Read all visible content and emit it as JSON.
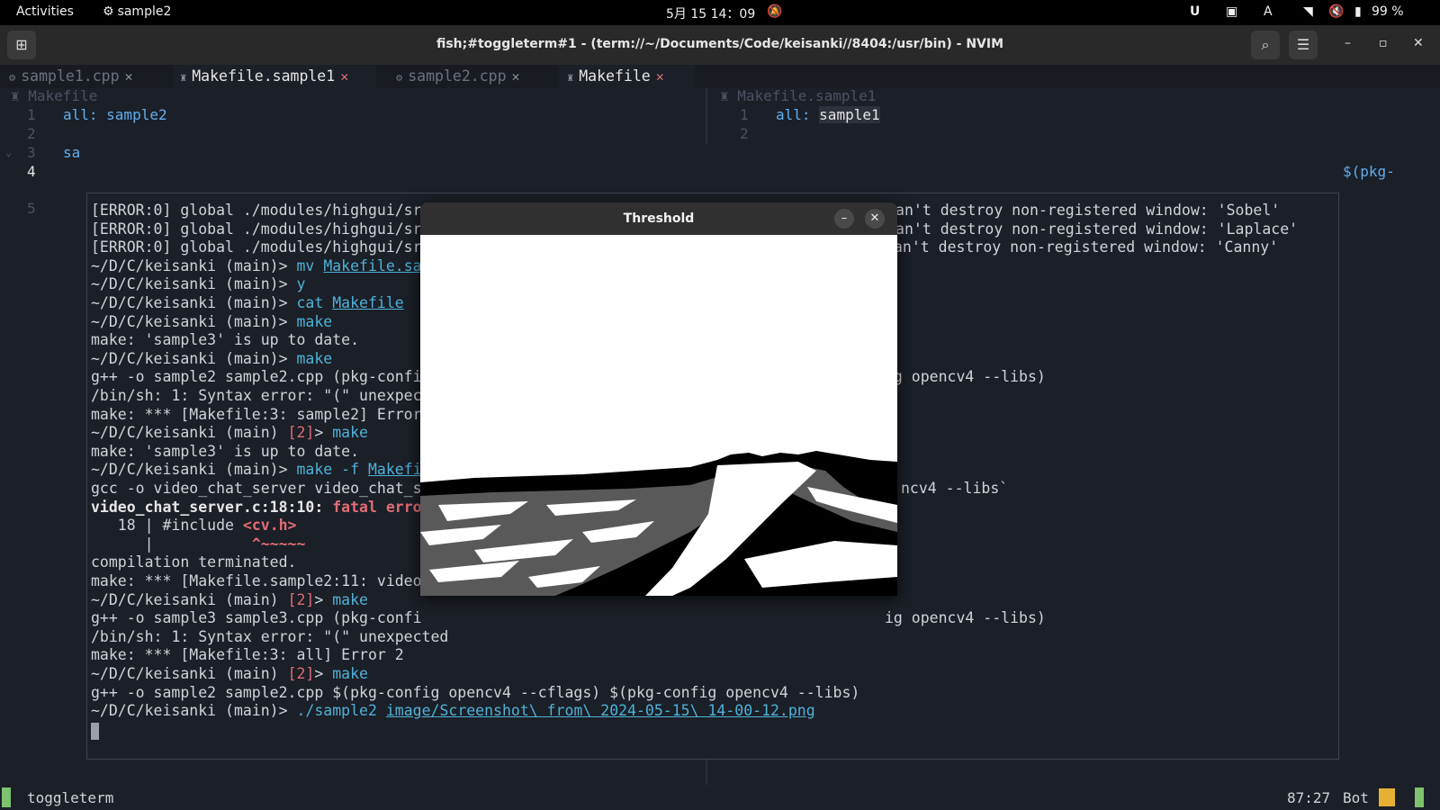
{
  "topbar": {
    "activities": "Activities",
    "app_name": "sample2",
    "clock": "5月 15  14：09",
    "input_method": "A",
    "battery": "99 %"
  },
  "window": {
    "title": "fish;#toggleterm#1 - (term://~/Documents/Code/keisanki//8404:/usr/bin) - NVIM"
  },
  "tabs": [
    {
      "label": "sample1.cpp",
      "active": false
    },
    {
      "label": "Makefile.sample1",
      "active": true
    },
    {
      "label": "sample2.cpp",
      "active": false
    },
    {
      "label": "Makefile",
      "active": true
    }
  ],
  "left_pane": {
    "winbar": "Makefile",
    "lines": [
      {
        "num": "1",
        "text": "all: sample2"
      },
      {
        "num": "2",
        "text": ""
      },
      {
        "num": "3",
        "text": "sa"
      },
      {
        "num": "4",
        "text": ""
      },
      {
        "num": "5",
        "text": ""
      }
    ],
    "overflow_text": "$(pkg-"
  },
  "right_pane": {
    "winbar": "Makefile.sample1",
    "lines": [
      {
        "num": "1",
        "text_key": "all:",
        "text_val": "sample1"
      },
      {
        "num": "2",
        "text": ""
      }
    ]
  },
  "terminal": {
    "prompt": "~/D/C/keisanki",
    "branch": "(main)",
    "err_code": "[2]",
    "l1": "[ERROR:0] global ./modules/highgui/src/window_gtk.cpp (1344) cvDestroyWindow OpenCV/GTK: Can't destroy non-registered window: 'Sobel'",
    "l2": "[ERROR:0] global ./modules/highgui/src/window_gtk.cpp (1344) cvDestroyWindow OpenCV/GTK: Can't destroy non-registered window: 'Laplace'",
    "l3a": "[ERROR:0] global ./modules/highgui/src/",
    "l3b": "an't destroy non-registered window: 'Canny'",
    "cmd_mv": "mv",
    "cmd_mv_arg": "Makefile.sa",
    "cmd_y": "y",
    "cmd_cat": "cat",
    "cmd_cat_arg": "Makefile",
    "cmd_make": "make",
    "uptodate": "make: 'sample3' is up to date.",
    "gpp_s2a": "g++ -o sample2 sample2.cpp (pkg-confi",
    "gpp_s2b": "ig opencv4 --libs)",
    "syntax_a": "/bin/sh: 1: Syntax error: \"(\" unexpec",
    "make_err_s2": "make: *** [Makefile:3: sample2] Error",
    "cmd_make_f": "make -f",
    "cmd_make_f_arg": "Makefi",
    "gcc_a": "gcc -o video_chat_server video_chat_s",
    "gcc_b": "ncv4 --libs`",
    "fatal_file": "video_chat_server.c:18:10:",
    "fatal_word": "fatal erro",
    "include_num": "   18 | #include ",
    "include_hdr": "<cv.h>",
    "caret_bar": "      |           ",
    "caret": "^~~~~~",
    "comp_term": "compilation terminated.",
    "make_err_vid": "make: *** [Makefile.sample2:11: video",
    "gpp_s3a": "g++ -o sample3 sample3.cpp (pkg-confi",
    "gpp_s3b": "ig opencv4 --libs)",
    "syntax_full": "/bin/sh: 1: Syntax error: \"(\" unexpected",
    "make_err_all": "make: *** [Makefile:3: all] Error 2",
    "gpp_final": "g++ -o sample2 sample2.cpp $(pkg-config opencv4 --cflags) $(pkg-config opencv4 --libs)",
    "run_cmd": "./sample2",
    "run_arg": "image/Screenshot\\ from\\ 2024-05-15\\ 14-00-12.png"
  },
  "threshold_window": {
    "title": "Threshold",
    "minimize": "–",
    "close": "✕"
  },
  "statusline": {
    "mode": "toggleterm",
    "position": "87:27",
    "scroll": "Bot"
  }
}
